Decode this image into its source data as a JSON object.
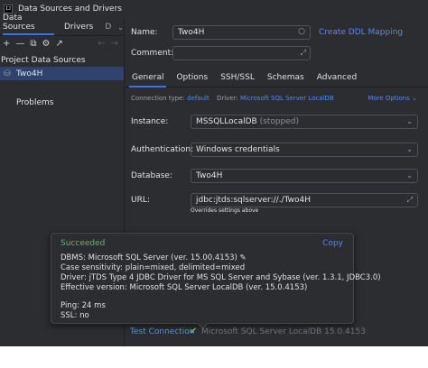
{
  "window": {
    "title": "Data Sources and Drivers",
    "app_icon": "IJ"
  },
  "left": {
    "tabs": [
      {
        "label": "Data Sources"
      },
      {
        "label": "Drivers"
      },
      {
        "label": "D"
      }
    ],
    "toolbar": {
      "add": "+",
      "remove": "—",
      "copy": "⧉",
      "settings": "⚙",
      "export": "↗",
      "back": "←",
      "forward": "→"
    },
    "section_label": "Project Data Sources",
    "data_source": {
      "name": "Two4H"
    },
    "problems_label": "Problems"
  },
  "form": {
    "name_label": "Name:",
    "name_value": "Two4H",
    "ddl_link": "Create DDL Mapping",
    "comment_label": "Comment:",
    "comment_value": "",
    "tabs": [
      "General",
      "Options",
      "SSH/SSL",
      "Schemas",
      "Advanced"
    ],
    "connection_type_label": "Connection type:",
    "connection_type_value": "default",
    "driver_label": "Driver:",
    "driver_value": "Microsoft SQL Server LocalDB",
    "more_options": "More Options",
    "instance_label": "Instance:",
    "instance_value": "MSSQLLocalDB",
    "instance_status": "(stopped)",
    "auth_label": "Authentication:",
    "auth_value": "Windows credentials",
    "database_label": "Database:",
    "database_value": "Two4H",
    "url_label": "URL:",
    "url_value": "jdbc:jtds:sqlserver://./Two4H",
    "url_hint": "Overrides settings above"
  },
  "popup": {
    "status": "Succeeded",
    "copy_label": "Copy",
    "lines": [
      "DBMS: Microsoft SQL Server (ver. 15.00.4153)",
      "Case sensitivity: plain=mixed, delimited=mixed",
      "Driver: jTDS Type 4 JDBC Driver for MS SQL Server and Sybase (ver. 1.3.1, JDBC3.0)",
      "Effective version: Microsoft SQL Server LocalDB (ver. 15.0.4153)",
      "Ping: 24 ms",
      "SSL: no"
    ]
  },
  "footer": {
    "test_connection": "Test Connection",
    "check_glyph": "✔",
    "test_result": "Microsoft SQL Server LocalDB 15.0.4153"
  },
  "colors": {
    "background": "#2b2d30",
    "accent": "#3574f0",
    "link": "#548af7",
    "success": "#5fb865"
  }
}
